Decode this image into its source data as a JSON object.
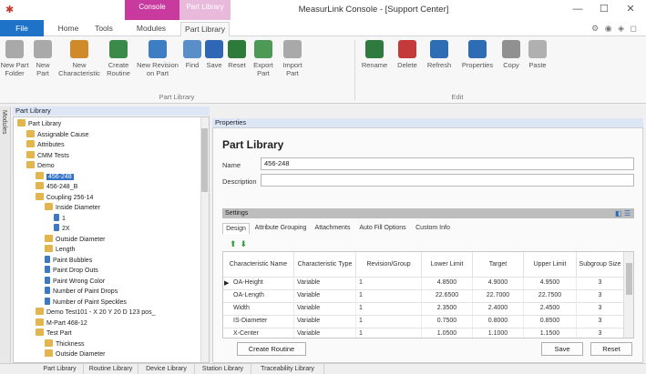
{
  "window": {
    "title": "MeasurLink Console - [Support Center]",
    "context_tabs": [
      "Console",
      "Part Library"
    ],
    "controls": {
      "minimize": "—",
      "maximize": "☐",
      "close": "✕"
    }
  },
  "ribbon_tabs": [
    {
      "label": "File"
    },
    {
      "label": "Home"
    },
    {
      "label": "Tools"
    },
    {
      "label": "Modules"
    },
    {
      "label": "Part Library"
    }
  ],
  "ribbon": {
    "part_library_group": {
      "label": "Part Library",
      "buttons": [
        {
          "label": "New Part Folder",
          "icon": "new-part-folder-icon",
          "color": "#a9a9a9"
        },
        {
          "label": "New Part",
          "icon": "new-part-icon",
          "color": "#a9a9a9"
        },
        {
          "label": "New Characteristic",
          "icon": "new-characteristic-icon",
          "color": "#d08a2a"
        },
        {
          "label": "Create Routine",
          "icon": "create-routine-icon",
          "color": "#3a8a4a"
        },
        {
          "label": "New Revision on Part",
          "icon": "new-revision-icon",
          "color": "#3d7dc4"
        },
        {
          "label": "Find",
          "icon": "find-icon",
          "color": "#5a8ec9"
        },
        {
          "label": "Save",
          "icon": "save-icon",
          "color": "#2f67b6"
        },
        {
          "label": "Reset",
          "icon": "reset-icon",
          "color": "#2e7a3a"
        },
        {
          "label": "Export Part",
          "icon": "export-part-icon",
          "color": "#4d9a56"
        },
        {
          "label": "Import Part",
          "icon": "import-part-icon",
          "color": "#a9a9a9"
        }
      ]
    },
    "edit_group": {
      "label": "Edit",
      "buttons": [
        {
          "label": "Rename",
          "icon": "rename-icon",
          "color": "#2f7b3f"
        },
        {
          "label": "Delete",
          "icon": "delete-icon",
          "color": "#c43a3a"
        },
        {
          "label": "Refresh",
          "icon": "refresh-icon",
          "color": "#2e6db4"
        },
        {
          "label": "Properties",
          "icon": "properties-icon",
          "color": "#2e6db4"
        },
        {
          "label": "Copy",
          "icon": "copy-icon",
          "color": "#909090"
        },
        {
          "label": "Paste",
          "icon": "paste-icon",
          "color": "#b0b0b0"
        }
      ]
    }
  },
  "sidebar": {
    "modules_label": "Modules"
  },
  "part_library_panel": {
    "header": "Part Library",
    "tree": [
      {
        "label": "Part Library",
        "level": 0
      },
      {
        "label": "Assignable Cause",
        "level": 1
      },
      {
        "label": "Attributes",
        "level": 1
      },
      {
        "label": "CMM Tests",
        "level": 1
      },
      {
        "label": "Demo",
        "level": 1
      },
      {
        "label": "456-248",
        "level": 2,
        "selected": true
      },
      {
        "label": "456-248_B",
        "level": 2
      },
      {
        "label": "Coupling 256-14",
        "level": 2
      },
      {
        "label": "Inside Diameter",
        "level": 3
      },
      {
        "label": "1",
        "level": 4,
        "doc": true
      },
      {
        "label": "2X",
        "level": 4,
        "doc": true
      },
      {
        "label": "Outside Diameter",
        "level": 3
      },
      {
        "label": "Length",
        "level": 3
      },
      {
        "label": "Paint Bubbles",
        "level": 3,
        "doc": true
      },
      {
        "label": "Paint Drop Outs",
        "level": 3,
        "doc": true
      },
      {
        "label": "Paint Wrong Color",
        "level": 3,
        "doc": true
      },
      {
        "label": "Number of Paint Drops",
        "level": 3,
        "doc": true
      },
      {
        "label": "Number of Paint Speckles",
        "level": 3,
        "doc": true
      },
      {
        "label": "Demo Test101 - X 20 Y 20 D 123 pos_",
        "level": 2
      },
      {
        "label": "M-Part 468-12",
        "level": 2
      },
      {
        "label": "Test Part",
        "level": 2
      },
      {
        "label": "Thickness",
        "level": 3
      },
      {
        "label": "Outside Diameter",
        "level": 3
      }
    ]
  },
  "properties_panel": {
    "header": "Properties",
    "title": "Part Library",
    "name_label": "Name",
    "name_value": "456-248",
    "description_label": "Description",
    "description_value": "",
    "settings_label": "Settings",
    "sub_tabs": [
      "Design",
      "Attribute Grouping",
      "Attachments",
      "Auto Fill Options",
      "Custom Info"
    ],
    "grid": {
      "columns": [
        "Characteristic Name",
        "Characteristic Type",
        "Revision/Group",
        "Lower Limit",
        "Target",
        "Upper Limit",
        "Subgroup Size"
      ],
      "rows": [
        {
          "name": "OA-Height",
          "type": "Variable",
          "rev": "1",
          "lower": "4.8500",
          "target": "4.9000",
          "upper": "4.9500",
          "size": "3"
        },
        {
          "name": "OA-Length",
          "type": "Variable",
          "rev": "1",
          "lower": "22.6500",
          "target": "22.7000",
          "upper": "22.7500",
          "size": "3"
        },
        {
          "name": "Width",
          "type": "Variable",
          "rev": "1",
          "lower": "2.3500",
          "target": "2.4000",
          "upper": "2.4500",
          "size": "3"
        },
        {
          "name": "IS-Diameter",
          "type": "Variable",
          "rev": "1",
          "lower": "0.7500",
          "target": "0.8000",
          "upper": "0.8500",
          "size": "3"
        },
        {
          "name": "X-Center",
          "type": "Variable",
          "rev": "1",
          "lower": "1.0500",
          "target": "1.1000",
          "upper": "1.1500",
          "size": "3"
        }
      ]
    },
    "create_routine_label": "Create Routine",
    "save_label": "Save",
    "reset_label": "Reset"
  },
  "bottom_tabs": [
    "Part Library",
    "Routine Library",
    "Device Library",
    "Station Library",
    "Traceability Library"
  ]
}
